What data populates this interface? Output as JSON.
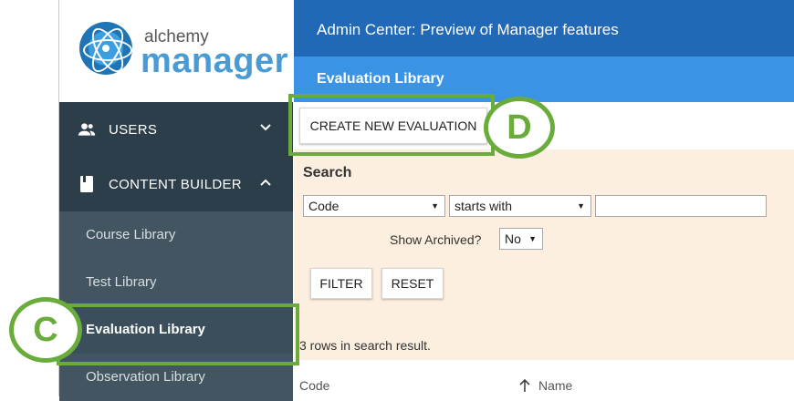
{
  "logo": {
    "line1": "alchemy",
    "line2": "manager"
  },
  "header": {
    "title": "Admin Center: Preview of Manager features",
    "subtitle": "Evaluation Library"
  },
  "sidebar": {
    "users_label": "USERS",
    "content_builder_label": "CONTENT BUILDER",
    "items": [
      {
        "label": "Course Library"
      },
      {
        "label": "Test Library"
      },
      {
        "label": "Evaluation Library"
      },
      {
        "label": "Observation Library"
      }
    ]
  },
  "toolbar": {
    "create_label": "CREATE NEW EVALUATION"
  },
  "search": {
    "title": "Search",
    "field_value": "Code",
    "operator_value": "starts with",
    "text_value": "",
    "archived_label": "Show Archived?",
    "archived_value": "No",
    "filter_label": "FILTER",
    "reset_label": "RESET"
  },
  "results": {
    "count_text": "3 rows in search result."
  },
  "table": {
    "columns": [
      "Code",
      "Name"
    ]
  },
  "annotations": {
    "d_label": "D",
    "c_label": "C"
  },
  "colors": {
    "annotation_green": "#6aac3c",
    "header_blue": "#2169b6",
    "subheader_blue": "#3b93e6",
    "sidebar_dark": "#2d3e4b",
    "search_panel": "#fcefdf"
  }
}
